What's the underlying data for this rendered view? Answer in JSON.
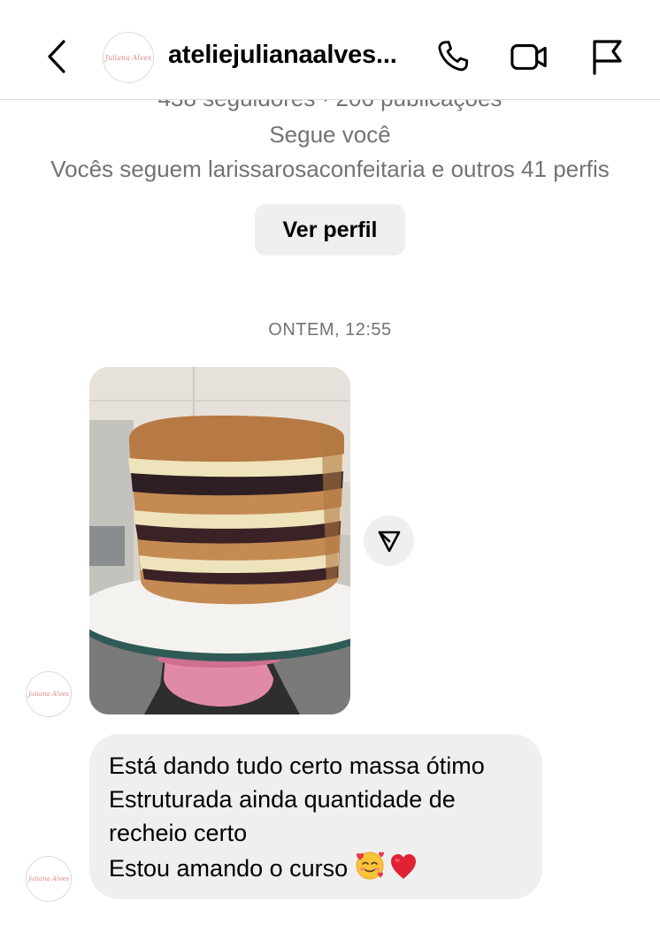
{
  "header": {
    "username": "ateliejulianaalves...",
    "avatar_logo_text": "Juliana Alves"
  },
  "profile": {
    "followers_line": "438 seguidores · 206 publicações",
    "follows_you": "Segue você",
    "mutual_followers": "Vocês seguem larissarosaconfeitaria e outros 41 perfis",
    "view_profile_label": "Ver perfil"
  },
  "thread": {
    "timestamp": "ONTEM, 12:55",
    "photo_message": {
      "description": "layered cake on turntable"
    },
    "text_message": {
      "lines": [
        "Está dando tudo certo massa ótimo",
        "Estruturada ainda quantidade de",
        "recheio certo",
        "Estou amando o curso"
      ],
      "emojis": [
        "smiling-face-with-hearts",
        "red-heart"
      ]
    }
  },
  "icons": {
    "back": "chevron-left-icon",
    "call": "phone-icon",
    "video": "video-camera-icon",
    "report": "flag-icon",
    "share": "paper-plane-icon"
  },
  "colors": {
    "secondary_text": "#737373",
    "button_bg": "#efefef",
    "bubble_bg": "#efefef",
    "logo_pink": "#d98a8a"
  }
}
